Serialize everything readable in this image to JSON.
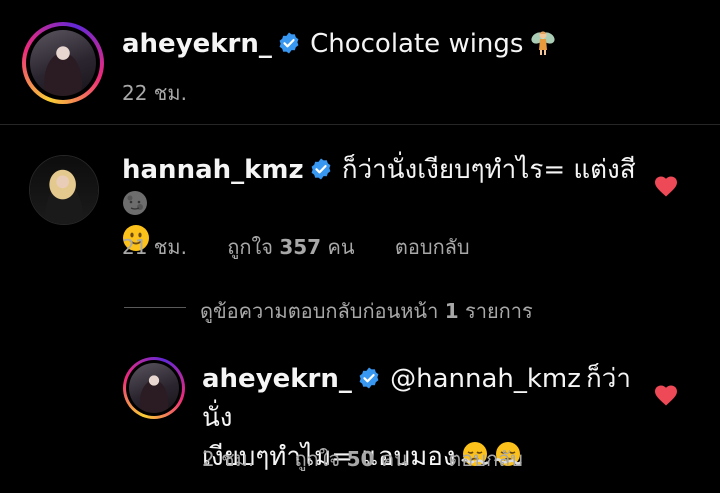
{
  "caption": {
    "username": "aheyekrn_",
    "text": "Chocolate wings",
    "emoji_icon": "fairy-icon",
    "time": "22 ชม."
  },
  "comment1": {
    "username": "hannah_kmz",
    "text_line1": "ก็ว่านั่งเงียบๆทำไร= แต่งสี",
    "emoji_line1_icon": "new-moon-face-icon",
    "emoji_line2_icon": "slightly-smiling-face-icon",
    "time": "21 ชม.",
    "likes_prefix": "ถูกใจ",
    "likes_count": "357",
    "likes_suffix": "คน",
    "reply_label": "ตอบกลับ",
    "heart_color": "#ed4956"
  },
  "view_replies": {
    "prefix": "ดูข้อความตอบกลับก่อนหน้า",
    "count": "1",
    "suffix": "รายการ"
  },
  "reply": {
    "username": "aheyekrn_",
    "mention": "@hannah_kmz",
    "text_line1": "ก็ว่านั่ง",
    "text_line2": "เงียบๆทำไม= แอบมอง",
    "emoji_icons": [
      "face-with-steam-icon",
      "face-with-steam-icon"
    ],
    "time": "2 ชม.",
    "likes_prefix": "ถูกใจ",
    "likes_count": "50",
    "likes_suffix": "คน",
    "reply_label": "ตอบกลับ",
    "heart_color": "#ed4956"
  },
  "colors": {
    "background": "#000000",
    "text": "#f5f5f5",
    "meta": "#a8a8a8",
    "verified": "#3897f0",
    "like": "#ed4956"
  }
}
